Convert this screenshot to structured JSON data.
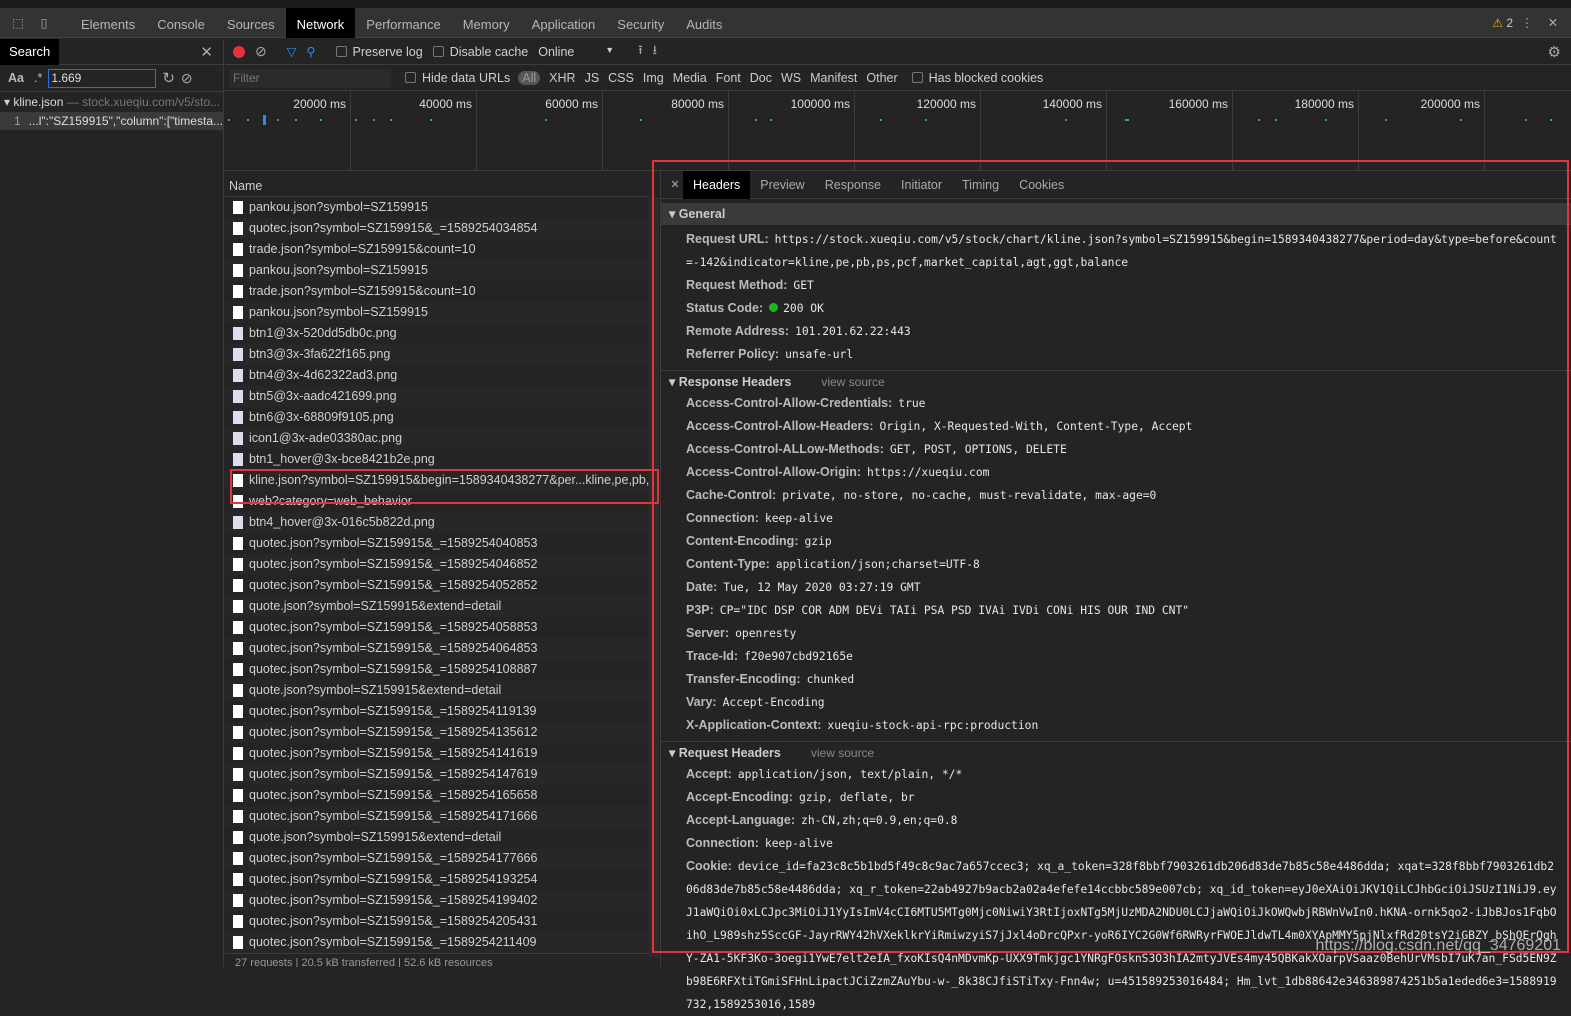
{
  "devtools": {
    "tabs": [
      "Elements",
      "Console",
      "Sources",
      "Network",
      "Performance",
      "Memory",
      "Application",
      "Security",
      "Audits"
    ],
    "active_tab": "Network",
    "warnings": "2"
  },
  "search": {
    "title": "Search",
    "aa": "Aa",
    "regex": ".*",
    "query": "1.669",
    "result_file": "kline.json",
    "result_url": "— stock.xueqiu.com/v5/sto...",
    "result_line_no": "1",
    "result_line": "...l\":\"SZ159915\",\"column\":[\"timesta..."
  },
  "toolbar": {
    "preserve_log": "Preserve log",
    "disable_cache": "Disable cache",
    "throttle": "Online"
  },
  "filter": {
    "placeholder": "Filter",
    "hide_data_urls": "Hide data URLs",
    "types": [
      "All",
      "XHR",
      "JS",
      "CSS",
      "Img",
      "Media",
      "Font",
      "Doc",
      "WS",
      "Manifest",
      "Other"
    ],
    "has_blocked_cookies": "Has blocked cookies"
  },
  "timeline": {
    "ticks": [
      "20000 ms",
      "40000 ms",
      "60000 ms",
      "80000 ms",
      "100000 ms",
      "120000 ms",
      "140000 ms",
      "160000 ms",
      "180000 ms",
      "200000 ms",
      "220"
    ]
  },
  "requests": {
    "header": "Name",
    "rows": [
      {
        "name": "pankou.json?symbol=SZ159915",
        "type": "doc"
      },
      {
        "name": "quotec.json?symbol=SZ159915&_=1589254034854",
        "type": "doc"
      },
      {
        "name": "trade.json?symbol=SZ159915&count=10",
        "type": "doc"
      },
      {
        "name": "pankou.json?symbol=SZ159915",
        "type": "doc"
      },
      {
        "name": "trade.json?symbol=SZ159915&count=10",
        "type": "doc"
      },
      {
        "name": "pankou.json?symbol=SZ159915",
        "type": "doc"
      },
      {
        "name": "btn1@3x-520dd5db0c.png",
        "type": "img"
      },
      {
        "name": "btn3@3x-3fa622f165.png",
        "type": "img"
      },
      {
        "name": "btn4@3x-4d62322ad3.png",
        "type": "img"
      },
      {
        "name": "btn5@3x-aadc421699.png",
        "type": "img"
      },
      {
        "name": "btn6@3x-68809f9105.png",
        "type": "img"
      },
      {
        "name": "icon1@3x-ade03380ac.png",
        "type": "img"
      },
      {
        "name": "btn1_hover@3x-bce8421b2e.png",
        "type": "img"
      },
      {
        "name": "kline.json?symbol=SZ159915&begin=1589340438277&per...kline,pe,pb,ps,",
        "type": "doc"
      },
      {
        "name": "web?category=web_behavior",
        "type": "doc"
      },
      {
        "name": "btn4_hover@3x-016c5b822d.png",
        "type": "img"
      },
      {
        "name": "quotec.json?symbol=SZ159915&_=1589254040853",
        "type": "doc"
      },
      {
        "name": "quotec.json?symbol=SZ159915&_=1589254046852",
        "type": "doc"
      },
      {
        "name": "quotec.json?symbol=SZ159915&_=1589254052852",
        "type": "doc"
      },
      {
        "name": "quote.json?symbol=SZ159915&extend=detail",
        "type": "doc"
      },
      {
        "name": "quotec.json?symbol=SZ159915&_=1589254058853",
        "type": "doc"
      },
      {
        "name": "quotec.json?symbol=SZ159915&_=1589254064853",
        "type": "doc"
      },
      {
        "name": "quotec.json?symbol=SZ159915&_=1589254108887",
        "type": "doc"
      },
      {
        "name": "quote.json?symbol=SZ159915&extend=detail",
        "type": "doc"
      },
      {
        "name": "quotec.json?symbol=SZ159915&_=1589254119139",
        "type": "doc"
      },
      {
        "name": "quotec.json?symbol=SZ159915&_=1589254135612",
        "type": "doc"
      },
      {
        "name": "quotec.json?symbol=SZ159915&_=1589254141619",
        "type": "doc"
      },
      {
        "name": "quotec.json?symbol=SZ159915&_=1589254147619",
        "type": "doc"
      },
      {
        "name": "quotec.json?symbol=SZ159915&_=1589254165658",
        "type": "doc"
      },
      {
        "name": "quotec.json?symbol=SZ159915&_=1589254171666",
        "type": "doc"
      },
      {
        "name": "quote.json?symbol=SZ159915&extend=detail",
        "type": "doc"
      },
      {
        "name": "quotec.json?symbol=SZ159915&_=1589254177666",
        "type": "doc"
      },
      {
        "name": "quotec.json?symbol=SZ159915&_=1589254193254",
        "type": "doc"
      },
      {
        "name": "quotec.json?symbol=SZ159915&_=1589254199402",
        "type": "doc"
      },
      {
        "name": "quotec.json?symbol=SZ159915&_=1589254205431",
        "type": "doc"
      },
      {
        "name": "quotec.json?symbol=SZ159915&_=1589254211409",
        "type": "doc"
      }
    ],
    "status": "27 requests | 20.5 kB transferred | 52.6 kB resources"
  },
  "detail": {
    "tabs": [
      "Headers",
      "Preview",
      "Response",
      "Initiator",
      "Timing",
      "Cookies"
    ],
    "active": "Headers",
    "general": {
      "title": "General",
      "items": [
        {
          "k": "Request URL:",
          "v": "https://stock.xueqiu.com/v5/stock/chart/kline.json?symbol=SZ159915&begin=1589340438277&period=day&type=before&count=-142&indicator=kline,pe,pb,ps,pcf,market_capital,agt,ggt,balance"
        },
        {
          "k": "Request Method:",
          "v": "GET"
        },
        {
          "k": "Status Code:",
          "v": "200 OK"
        },
        {
          "k": "Remote Address:",
          "v": "101.201.62.22:443"
        },
        {
          "k": "Referrer Policy:",
          "v": "unsafe-url"
        }
      ]
    },
    "response_headers": {
      "title": "Response Headers",
      "view_source": "view source",
      "items": [
        {
          "k": "Access-Control-Allow-Credentials:",
          "v": "true"
        },
        {
          "k": "Access-Control-Allow-Headers:",
          "v": "Origin, X-Requested-With, Content-Type, Accept"
        },
        {
          "k": "Access-Control-ALLow-Methods:",
          "v": "GET, POST, OPTIONS, DELETE"
        },
        {
          "k": "Access-Control-Allow-Origin:",
          "v": "https://xueqiu.com"
        },
        {
          "k": "Cache-Control:",
          "v": "private, no-store, no-cache, must-revalidate, max-age=0"
        },
        {
          "k": "Connection:",
          "v": "keep-alive"
        },
        {
          "k": "Content-Encoding:",
          "v": "gzip"
        },
        {
          "k": "Content-Type:",
          "v": "application/json;charset=UTF-8"
        },
        {
          "k": "Date:",
          "v": "Tue, 12 May 2020 03:27:19 GMT"
        },
        {
          "k": "P3P:",
          "v": "CP=\"IDC DSP COR ADM DEVi TAIi PSA PSD IVAi IVDi CONi HIS OUR IND CNT\""
        },
        {
          "k": "Server:",
          "v": "openresty"
        },
        {
          "k": "Trace-Id:",
          "v": "f20e907cbd92165e"
        },
        {
          "k": "Transfer-Encoding:",
          "v": "chunked"
        },
        {
          "k": "Vary:",
          "v": "Accept-Encoding"
        },
        {
          "k": "X-Application-Context:",
          "v": "xueqiu-stock-api-rpc:production"
        }
      ]
    },
    "request_headers": {
      "title": "Request Headers",
      "view_source": "view source",
      "items": [
        {
          "k": "Accept:",
          "v": "application/json, text/plain, */*"
        },
        {
          "k": "Accept-Encoding:",
          "v": "gzip, deflate, br"
        },
        {
          "k": "Accept-Language:",
          "v": "zh-CN,zh;q=0.9,en;q=0.8"
        },
        {
          "k": "Connection:",
          "v": "keep-alive"
        },
        {
          "k": "Cookie:",
          "v": "device_id=fa23c8c5b1bd5f49c8c9ac7a657ccec3; xq_a_token=328f8bbf7903261db206d83de7b85c58e4486dda; xqat=328f8bbf7903261db206d83de7b85c58e4486dda; xq_r_token=22ab4927b9acb2a02a4efefe14ccbbc589e007cb; xq_id_token=eyJ0eXAiOiJKV1QiLCJhbGciOiJSUzI1NiJ9.eyJ1aWQiOi0xLCJpc3MiOiJ1YyIsImV4cCI6MTU5MTg0Mjc0NiwiY3RtIjoxNTg5MjUzMDA2NDU0LCJjaWQiOiJkOWQwbjRBWnVwIn0.hKNA-ornk5qo2-iJbBJos1FqbOihO_L989shz5SccGF-JayrRWY42hVXeklkrYiRmiwzyiS7jJxl4oDrcQPxr-yoR6IYC2G0Wf6RWRyrFWOEJldwTL4m0XYApMMY5pjNlxfRd20tsY2iGBZY_bShOErQghY-ZA1-5KF3Ko-3oegi1YwE7elt2eIA_fxoKIsQ4nMDvmKp-UXX9Tmkjgc1YNRgFOsknS3O3hIA2mtyJVEs4my45QBKakXOarpVSaaz0BehUrVMsbI7uK7an_FSd5EN9Zb98E6RFXtiTGmiSFHnLipactJCiZzmZAuYbu-w-_8k38CJfiSTiTxy-Fnn4w; u=451589253016484; Hm_lvt_1db88642e346389874251b5a1eded6e3=1588919732,1589253016,1589"
        }
      ]
    }
  },
  "watermark": "https://blog.csdn.net/qq_34769201",
  "colors": {
    "highlight_box": "#e8323a",
    "record": "#e8323a",
    "status_ok": "#1db820",
    "accent": "#1a73e8"
  }
}
